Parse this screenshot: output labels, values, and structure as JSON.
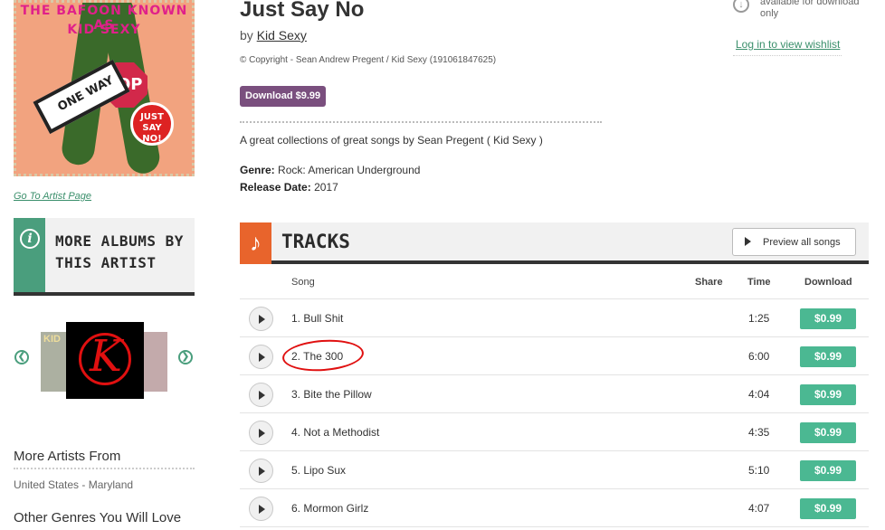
{
  "cover": {
    "line1": "THE BAFOON  KNOWN AS",
    "line2": "KID SEXY",
    "stop_text": "OP",
    "one_way_text": "ONE WAY",
    "badge_text": "JUST SAY NO!"
  },
  "sidebar": {
    "artist_page_link": "Go To Artist Page",
    "more_albums_title": "MORE ALBUMS BY THIS ARTIST",
    "carousel_thumb_text": "KID",
    "more_artists_heading": "More Artists From",
    "more_artists_location": "United States - Maryland",
    "other_genres_heading": "Other Genres You Will Love"
  },
  "album": {
    "title": "Just Say No",
    "by_prefix": "by",
    "artist": "Kid Sexy",
    "copyright": "© Copyright - Sean Andrew Pregent / Kid Sexy (191061847625)",
    "download_label": "Download $9.99",
    "description": "A great collections of great songs by Sean Pregent ( Kid Sexy )",
    "genre_label": "Genre:",
    "genre": "Rock: American Underground",
    "release_label": "Release Date:",
    "release_date": "2017"
  },
  "aside": {
    "download_note": "available for download only",
    "wishlist_link": "Log in to view wishlist"
  },
  "tracks": {
    "title": "TRACKS",
    "preview_all_label": "Preview all songs",
    "columns": {
      "song": "Song",
      "share": "Share",
      "time": "Time",
      "download": "Download"
    },
    "rows": [
      {
        "name": "1. Bull Shit",
        "time": "1:25",
        "price": "$0.99"
      },
      {
        "name": "2. The 300",
        "time": "6:00",
        "price": "$0.99"
      },
      {
        "name": "3. Bite the Pillow",
        "time": "4:04",
        "price": "$0.99"
      },
      {
        "name": "4. Not a Methodist",
        "time": "4:35",
        "price": "$0.99"
      },
      {
        "name": "5. Lipo Sux",
        "time": "5:10",
        "price": "$0.99"
      },
      {
        "name": "6. Mormon Girlz",
        "time": "4:07",
        "price": "$0.99"
      }
    ]
  },
  "colors": {
    "accent_green": "#4bb892",
    "download_purple": "#7a4f7e",
    "tracks_orange": "#e8642c",
    "annotation_red": "#e01010"
  }
}
